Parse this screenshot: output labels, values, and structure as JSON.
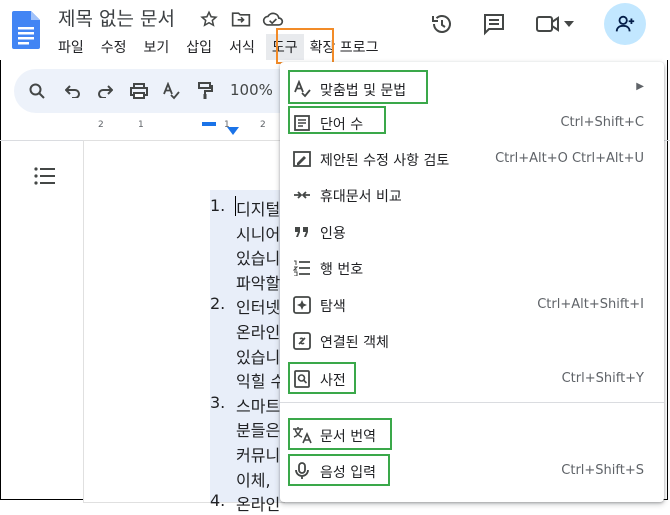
{
  "doc": {
    "title": "제목 없는 문서",
    "menu_items": [
      "파일",
      "수정",
      "보기",
      "삽입",
      "서식",
      "도구",
      "확장 프로그"
    ],
    "zoom": "100%",
    "ruler_marks": [
      "2",
      "1",
      "1",
      "2"
    ]
  },
  "document_lines": [
    {
      "text": "1.",
      "kind": "num"
    },
    {
      "text": "디지털"
    },
    {
      "text": "시니어"
    },
    {
      "text": "있습니"
    },
    {
      "text": "파악할"
    },
    {
      "text": "2.",
      "kind": "num"
    },
    {
      "text": "인터넷"
    },
    {
      "text": "온라인"
    },
    {
      "text": "있습니"
    },
    {
      "text": "익힐 수"
    },
    {
      "text": "3.",
      "kind": "num"
    },
    {
      "text": "스마트"
    },
    {
      "text": "분들은"
    },
    {
      "text": "커뮤니"
    },
    {
      "text": "이체,"
    },
    {
      "text": "4.",
      "kind": "num"
    },
    {
      "text": "온라인"
    }
  ],
  "tools_menu": [
    {
      "label": "맞춤법 및 문법",
      "shortcut": "",
      "has_submenu": true,
      "icon": "spellcheck-icon"
    },
    {
      "label": "단어 수",
      "shortcut": "Ctrl+Shift+C",
      "icon": "word-count-icon"
    },
    {
      "label": "제안된 수정 사항 검토",
      "shortcut": "Ctrl+Alt+O Ctrl+Alt+U",
      "icon": "review-edits-icon"
    },
    {
      "label": "휴대문서 비교",
      "shortcut": "",
      "icon": "compare-icon"
    },
    {
      "label": "인용",
      "shortcut": "",
      "icon": "quote-icon"
    },
    {
      "label": "행 번호",
      "shortcut": "",
      "icon": "line-numbers-icon"
    },
    {
      "label": "탐색",
      "shortcut": "Ctrl+Alt+Shift+I",
      "icon": "explore-icon"
    },
    {
      "label": "연결된 객체",
      "shortcut": "",
      "icon": "linked-objects-icon"
    },
    {
      "label": "사전",
      "shortcut": "Ctrl+Shift+Y",
      "icon": "dictionary-icon"
    },
    {
      "label": "문서 번역",
      "shortcut": "",
      "icon": "translate-icon"
    },
    {
      "label": "음성 입력",
      "shortcut": "Ctrl+Shift+S",
      "icon": "voice-input-icon"
    }
  ],
  "highlight_colors": {
    "menu_highlight": "#f28b28",
    "item_highlight": "#3aa84a"
  }
}
